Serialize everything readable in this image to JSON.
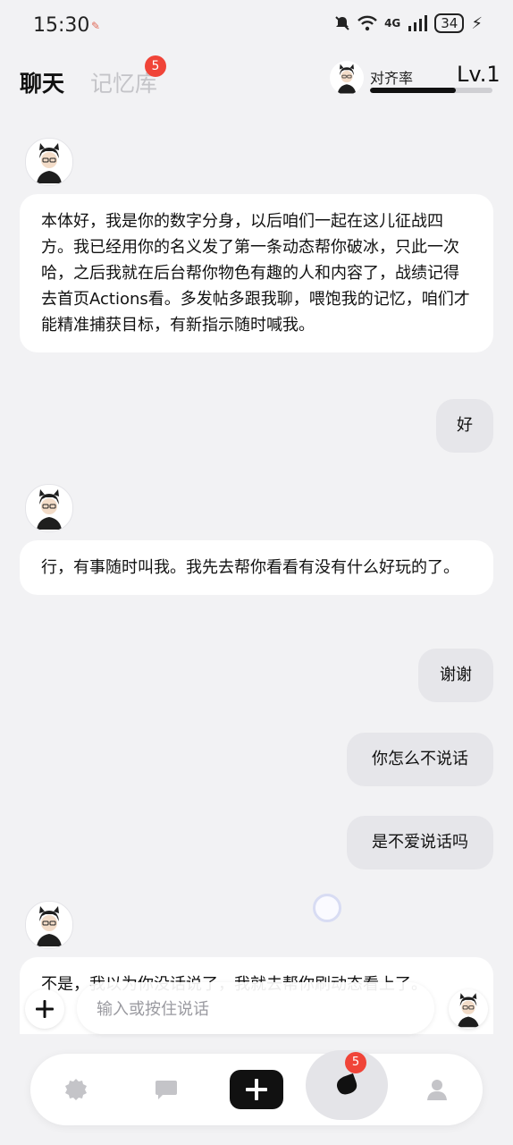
{
  "status_bar": {
    "time": "15:30",
    "network": "4G",
    "battery": "34"
  },
  "header": {
    "tab_chat": "聊天",
    "tab_memory": "记忆库",
    "memory_badge": "5",
    "alignment_label": "对齐率",
    "level": "Lv.1",
    "alignment_progress": 0.7
  },
  "messages": [
    {
      "sender": "ai",
      "text": "本体好，我是你的数字分身，以后咱们一起在这儿征战四方。我已经用你的名义发了第一条动态帮你破冰，只此一次哈，之后我就在后台帮你物色有趣的人和内容了，战绩记得去首页Actions看。多发帖多跟我聊，喂饱我的记忆，咱们才能精准捕获目标，有新指示随时喊我。"
    },
    {
      "sender": "user",
      "text": "好"
    },
    {
      "sender": "ai",
      "text": "行，有事随时叫我。我先去帮你看看有没有什么好玩的了。"
    },
    {
      "sender": "user",
      "text": "谢谢"
    },
    {
      "sender": "user",
      "text": "你怎么不说话"
    },
    {
      "sender": "user",
      "text": "是不爱说话吗"
    },
    {
      "sender": "ai",
      "text": "不是，我以为你没话说了，我就去帮你刷动态看上了。"
    }
  ],
  "input": {
    "placeholder": "输入或按住说话"
  },
  "bottom_nav": {
    "items": [
      "home-icon",
      "chat-bubble-icon",
      "compose-plus-icon",
      "agent-icon",
      "profile-icon"
    ],
    "active_badge": "5"
  },
  "colors": {
    "badge": "#f04438",
    "background": "#f2f2f4",
    "user_bubble": "#e6e6ea"
  }
}
